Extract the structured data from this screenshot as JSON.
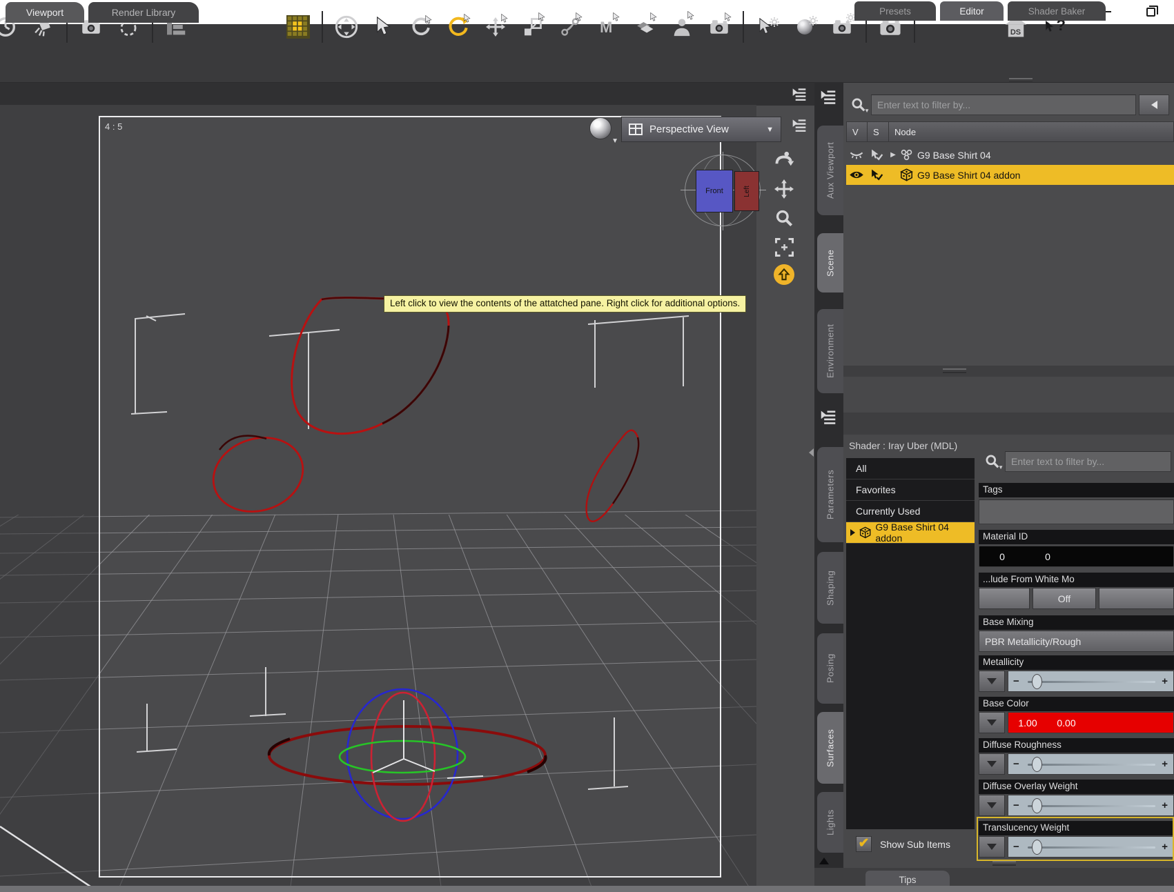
{
  "window": {
    "controls": [
      "minimize-icon",
      "restore-icon"
    ]
  },
  "toolbar": {
    "icons": [
      "timeline-gauge",
      "create-spotlight",
      "create-camera",
      "create-null",
      "node-list",
      "active-pane-grid",
      "viewport-nav",
      "node-selection-tool",
      "rotate-view-tool",
      "rotate-tool-active",
      "translate-tool",
      "scale-tool",
      "joint-editor-tool",
      "measure-tool",
      "surface-selection-tool",
      "figure-selection-tool",
      "spot-render-tool",
      "tool-settings",
      "render-settings",
      "frame-render",
      "render",
      "home",
      "help"
    ]
  },
  "tab_strip": {
    "tabs": [
      "Viewport",
      "Render Library"
    ],
    "active": "Viewport"
  },
  "viewport": {
    "aspect_ratio": "4 : 5",
    "camera_selector": "Perspective View",
    "view_cube": {
      "front_label": "Front",
      "left_label": "Left"
    },
    "tooltip": "Left click to view the contents of the attatched pane. Right click for additional options.",
    "nav_icons": [
      "orbit-icon",
      "pan-icon",
      "zoom-icon",
      "frame-icon",
      "aim-icon"
    ],
    "gizmo_colors": {
      "ring_flat": "#8a0b0b",
      "ring_green": "#27c427",
      "ring_blue": "#2222cc",
      "ring_red": "#cc2233"
    }
  },
  "scene_pane": {
    "side_tabs": [
      {
        "label": "Aux Viewport",
        "active": false
      },
      {
        "label": "Scene",
        "active": true
      },
      {
        "label": "Environment",
        "active": false
      }
    ],
    "filter_placeholder": "Enter text to filter by...",
    "columns": [
      "V",
      "S",
      "Node"
    ],
    "rows": [
      {
        "node": "G9 Base Shirt 04",
        "visibility": "hidden",
        "icon": "group-icon",
        "selected": false
      },
      {
        "node": "G9 Base Shirt 04 addon",
        "visibility": "visible",
        "icon": "cube-icon",
        "selected": true
      }
    ],
    "selection_color": "#eebc26"
  },
  "surfaces_pane": {
    "side_tabs": [
      {
        "label": "Parameters",
        "active": false
      },
      {
        "label": "Shaping",
        "active": false
      },
      {
        "label": "Posing",
        "active": false
      },
      {
        "label": "Surfaces",
        "active": true
      },
      {
        "label": "Lights",
        "active": false
      }
    ],
    "tabs": [
      {
        "label": "Presets",
        "active": false
      },
      {
        "label": "Editor",
        "active": true
      },
      {
        "label": "Shader Baker",
        "active": false
      }
    ],
    "shader_label": "Shader : Iray Uber (MDL)",
    "filter_list": [
      "All",
      "Favorites",
      "Currently Used"
    ],
    "selected_material": "G9 Base Shirt 04 addon",
    "filter_placeholder": "Enter text to filter by...",
    "properties": {
      "tags": {
        "label": "Tags",
        "value": ""
      },
      "material_id": {
        "label": "Material ID",
        "values": [
          "0",
          "0"
        ]
      },
      "exclude_white": {
        "label": "...lude From White Mo",
        "value": "Off"
      },
      "base_mixing": {
        "label": "Base Mixing",
        "value": "PBR Metallicity/Rough"
      },
      "metallicity": {
        "label": "Metallicity"
      },
      "base_color": {
        "label": "Base Color",
        "values": [
          "1.00",
          "0.00"
        ],
        "color": "#e60000"
      },
      "diffuse_roughness": {
        "label": "Diffuse Roughness"
      },
      "diffuse_overlay_weight": {
        "label": "Diffuse Overlay Weight"
      },
      "translucency_weight": {
        "label": "Translucency Weight",
        "highlighted": true
      }
    },
    "show_sub_items_label": "Show Sub Items",
    "tips_label": "Tips"
  }
}
